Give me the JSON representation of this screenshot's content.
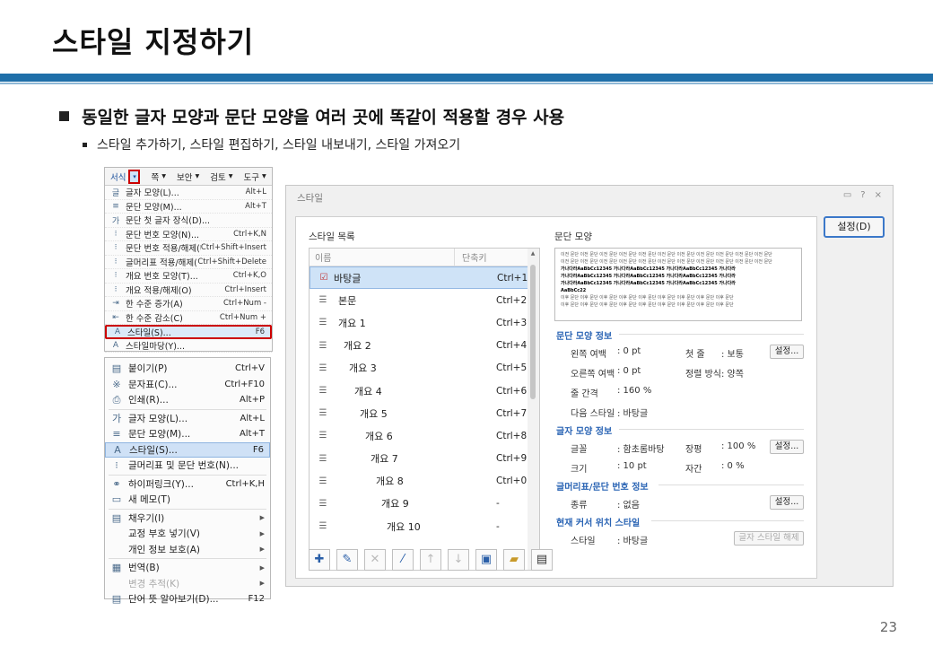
{
  "slide": {
    "title": "스타일 지정하기",
    "bullet1": "동일한 글자 모양과 문단 모양을 여러 곳에 똑같이 적용할 경우 사용",
    "bullet2": "스타일 추가하기, 스타일 편집하기, 스타일 내보내기, 스타일 가져오기",
    "page_number": "23"
  },
  "menu1": {
    "bar": [
      "서식",
      "쪽",
      "보안",
      "검토",
      "도구"
    ],
    "items": [
      {
        "label": "글자 모양(L)...",
        "shortcut": "Alt+L",
        "icon": "글"
      },
      {
        "label": "문단 모양(M)...",
        "shortcut": "Alt+T",
        "icon": "≡"
      },
      {
        "label": "문단 첫 글자 장식(D)...",
        "shortcut": "",
        "icon": "가"
      },
      {
        "label": "문단 번호 모양(N)...",
        "shortcut": "Ctrl+K,N",
        "icon": "⁝"
      },
      {
        "label": "문단 번호 적용/해제(U)",
        "shortcut": "Ctrl+Shift+Insert",
        "icon": "⁝"
      },
      {
        "label": "글머리표 적용/해제(B)",
        "shortcut": "Ctrl+Shift+Delete",
        "icon": "⁝"
      },
      {
        "label": "개요 번호 모양(T)...",
        "shortcut": "Ctrl+K,O",
        "icon": "⁝"
      },
      {
        "label": "개요 적용/해제(O)",
        "shortcut": "Ctrl+Insert",
        "icon": "⁝"
      },
      {
        "label": "한 수준 증가(A)",
        "shortcut": "Ctrl+Num -",
        "icon": "⇥"
      },
      {
        "label": "한 수준 감소(C)",
        "shortcut": "Ctrl+Num +",
        "icon": "⇤"
      },
      {
        "label": "스타일(S)...",
        "shortcut": "F6",
        "icon": "A"
      },
      {
        "label": "스타일마당(Y)...",
        "shortcut": "",
        "icon": "A"
      }
    ]
  },
  "menu2": {
    "items": [
      {
        "label": "붙이기(P)",
        "shortcut": "Ctrl+V",
        "icon": "▤"
      },
      {
        "label": "문자표(C)...",
        "shortcut": "Ctrl+F10",
        "icon": "※"
      },
      {
        "label": "인쇄(R)...",
        "shortcut": "Alt+P",
        "icon": "⎙"
      },
      {
        "label": "글자 모양(L)...",
        "shortcut": "Alt+L",
        "icon": "가"
      },
      {
        "label": "문단 모양(M)...",
        "shortcut": "Alt+T",
        "icon": "≡"
      },
      {
        "label": "스타일(S)...",
        "shortcut": "F6",
        "icon": "A"
      },
      {
        "label": "글머리표 및 문단 번호(N)...",
        "shortcut": "",
        "icon": "⁝"
      },
      {
        "label": "하이퍼링크(Y)...",
        "shortcut": "Ctrl+K,H",
        "icon": "⚭"
      },
      {
        "label": "새 메모(T)",
        "shortcut": "",
        "icon": "▭"
      },
      {
        "label": "채우기(I)",
        "shortcut": "",
        "icon": "▤"
      },
      {
        "label": "교정 부호 넣기(V)",
        "shortcut": "",
        "icon": ""
      },
      {
        "label": "개인 정보 보호(A)",
        "shortcut": "",
        "icon": ""
      },
      {
        "label": "번역(B)",
        "shortcut": "",
        "icon": "▦"
      },
      {
        "label": "변경 추적(K)",
        "shortcut": "",
        "icon": ""
      },
      {
        "label": "단어 뜻 알아보기(D)...",
        "shortcut": "F12",
        "icon": "▤"
      }
    ]
  },
  "dialog": {
    "title": "스타일",
    "ctrls": [
      "?",
      "×"
    ],
    "set_button": "설정(D)",
    "list_label": "스타일 목록",
    "col_name": "이름",
    "col_key": "단축키",
    "styles": [
      {
        "name": "바탕글",
        "key": "Ctrl+1",
        "indent": 0
      },
      {
        "name": "본문",
        "key": "Ctrl+2",
        "indent": 6
      },
      {
        "name": "개요 1",
        "key": "Ctrl+3",
        "indent": 6
      },
      {
        "name": "개요 2",
        "key": "Ctrl+4",
        "indent": 12
      },
      {
        "name": "개요 3",
        "key": "Ctrl+5",
        "indent": 18
      },
      {
        "name": "개요 4",
        "key": "Ctrl+6",
        "indent": 24
      },
      {
        "name": "개요 5",
        "key": "Ctrl+7",
        "indent": 30
      },
      {
        "name": "개요 6",
        "key": "Ctrl+8",
        "indent": 36
      },
      {
        "name": "개요 7",
        "key": "Ctrl+9",
        "indent": 42
      },
      {
        "name": "개요 8",
        "key": "Ctrl+0",
        "indent": 48
      },
      {
        "name": "개요 9",
        "key": "-",
        "indent": 54
      },
      {
        "name": "개요 10",
        "key": "-",
        "indent": 60
      }
    ],
    "preview_label": "문단 모양",
    "preview_gray": "이전 문단 이전 문단 이전 문단 이전 문단 이전 문단 이전 문단 이전 문단 이전 문단 이전 문단 이전 문단 이전 문단",
    "preview_bold": "가나다라AaBbCc12345 가나다라AaBbCc12345 가나다라AaBbCc12345 가나다라",
    "preview_bold_end": "AaBbCc22",
    "preview_after": "이후 문단 이후 문단 이후 문단 이후 문단 이후 문단 이후 문단 이후 문단 이후 문단 이후 문단",
    "para_group": "문단 모양 정보",
    "left_margin_label": "왼쪽 여백",
    "left_margin": ": 0 pt",
    "first_line_label": "첫 줄",
    "first_line": ": 보통",
    "right_margin_label": "오른쪽 여백",
    "right_margin": ": 0 pt",
    "align_label": "정렬 방식",
    "align": ": 양쪽",
    "line_spacing_label": "줄 간격",
    "line_spacing": ": 160 %",
    "next_style_label": "다음 스타일",
    "next_style": ": 바탕글",
    "char_group": "글자 모양 정보",
    "font_label": "글꼴",
    "font": ": 함초롬바탕",
    "ratio_label": "장평",
    "ratio": ": 100 %",
    "size_label": "크기",
    "size": ": 10 pt",
    "spacing_label": "자간",
    "spacing": ": 0 %",
    "bullet_group": "글머리표/문단 번호 정보",
    "kind_label": "종류",
    "kind": ": 없음",
    "cursor_group": "현재 커서 위치 스타일",
    "cur_style_label": "스타일",
    "cur_style": ": 바탕글",
    "btn_settings": "설정...",
    "btn_release": "글자 스타일 해제",
    "toolbar_icons": [
      "add-icon",
      "edit-icon",
      "delete-icon",
      "style-picker-icon",
      "move-up-icon",
      "move-down-icon",
      "import-icon",
      "open-folder-icon",
      "save-icon"
    ]
  }
}
